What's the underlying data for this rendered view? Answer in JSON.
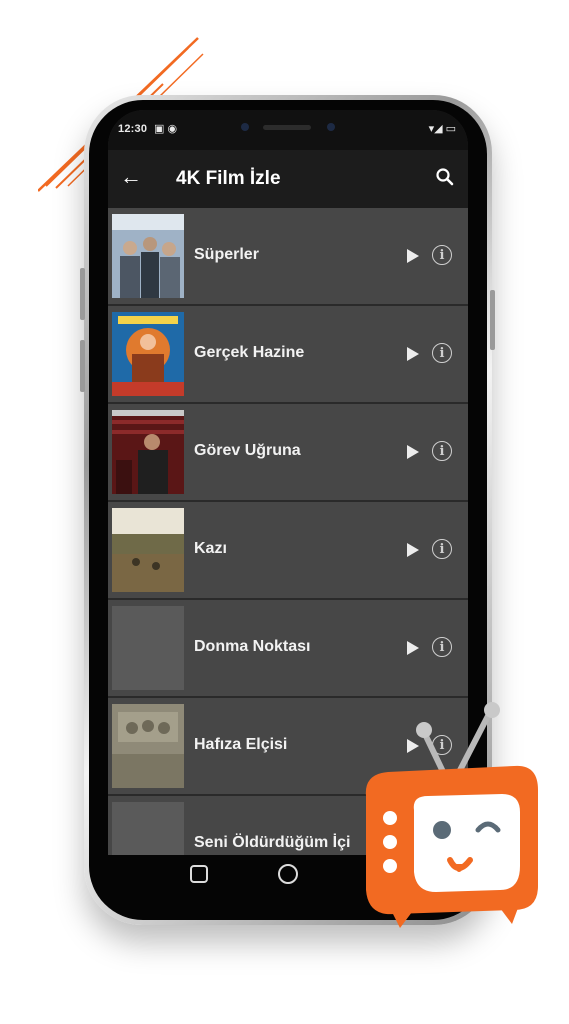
{
  "status_bar": {
    "time": "12:30"
  },
  "app_bar": {
    "title": "4K Film İzle"
  },
  "movies": [
    {
      "title": "Süperler"
    },
    {
      "title": "Gerçek Hazine"
    },
    {
      "title": "Görev Uğruna"
    },
    {
      "title": "Kazı"
    },
    {
      "title": "Donma Noktası"
    },
    {
      "title": "Hafıza Elçisi"
    },
    {
      "title": "Seni Öldürdüğüm İçi"
    }
  ],
  "colors": {
    "accent": "#f26a22",
    "row_background": "#474747",
    "app_bar": "#1c1c1c",
    "screen_background": "#2a2a2a"
  },
  "icons": {
    "back": "arrow-left-icon",
    "search": "search-icon",
    "play": "play-icon",
    "info": "info-icon"
  }
}
